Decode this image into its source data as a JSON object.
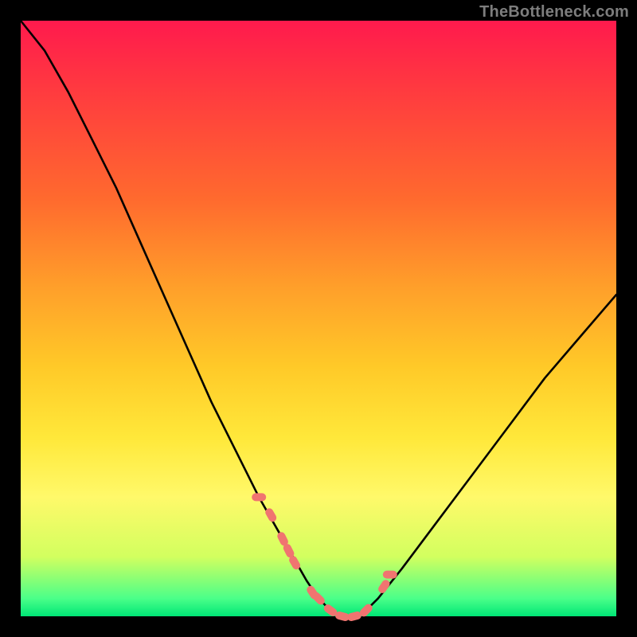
{
  "watermark": "TheBottleneck.com",
  "colors": {
    "background": "#000000",
    "curve": "#000000",
    "markers": "#f07470",
    "gradient_top": "#ff1a4d",
    "gradient_bottom": "#00e676"
  },
  "chart_data": {
    "type": "line",
    "title": "",
    "xlabel": "",
    "ylabel": "",
    "xlim": [
      0,
      100
    ],
    "ylim": [
      0,
      100
    ],
    "grid": false,
    "legend": false,
    "series": [
      {
        "name": "bottleneck-curve",
        "x": [
          0,
          4,
          8,
          12,
          16,
          20,
          24,
          28,
          32,
          36,
          40,
          44,
          48,
          50,
          52,
          54,
          56,
          58,
          60,
          64,
          70,
          76,
          82,
          88,
          94,
          100
        ],
        "y": [
          100,
          95,
          88,
          80,
          72,
          63,
          54,
          45,
          36,
          28,
          20,
          13,
          6,
          3,
          1,
          0,
          0,
          1,
          3,
          8,
          16,
          24,
          32,
          40,
          47,
          54
        ]
      }
    ],
    "markers": {
      "name": "highlight-points",
      "x": [
        40,
        42,
        44,
        45,
        46,
        49,
        50,
        52,
        54,
        56,
        58,
        61,
        62
      ],
      "y": [
        20,
        17,
        13,
        11,
        9,
        4,
        3,
        1,
        0,
        0,
        1,
        5,
        7
      ]
    }
  }
}
